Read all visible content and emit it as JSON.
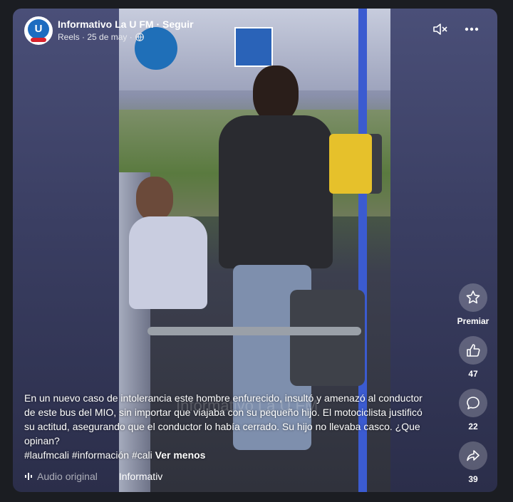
{
  "header": {
    "page_name": "Informativo La U FM · Seguir",
    "date": "Reels · 25 de may ·",
    "avatar_text": "U"
  },
  "video": {
    "watermark": "Informativo La U FM"
  },
  "actions": {
    "premiar_label": "Premiar",
    "like_count": "47",
    "comment_count": "22",
    "share_count": "39"
  },
  "caption": {
    "text": "En un nuevo caso de intolerancia este hombre enfurecido, insultó y amenazó al conductor de este bus del MIO, sin importar que viajaba con su pequeño hijo. El motociclista justificó su actitud, asegurando que el conductor lo había cerrado. Su hijo no llevaba casco. ¿Que opinan?",
    "hashtags": "#laufmcali #información #cali",
    "see_less": "Ver menos"
  },
  "footer": {
    "audio_label": "Audio original",
    "page_label": "Informativ"
  },
  "colors": {
    "accent": "#3b5bd0",
    "background": "#1b1d22"
  }
}
